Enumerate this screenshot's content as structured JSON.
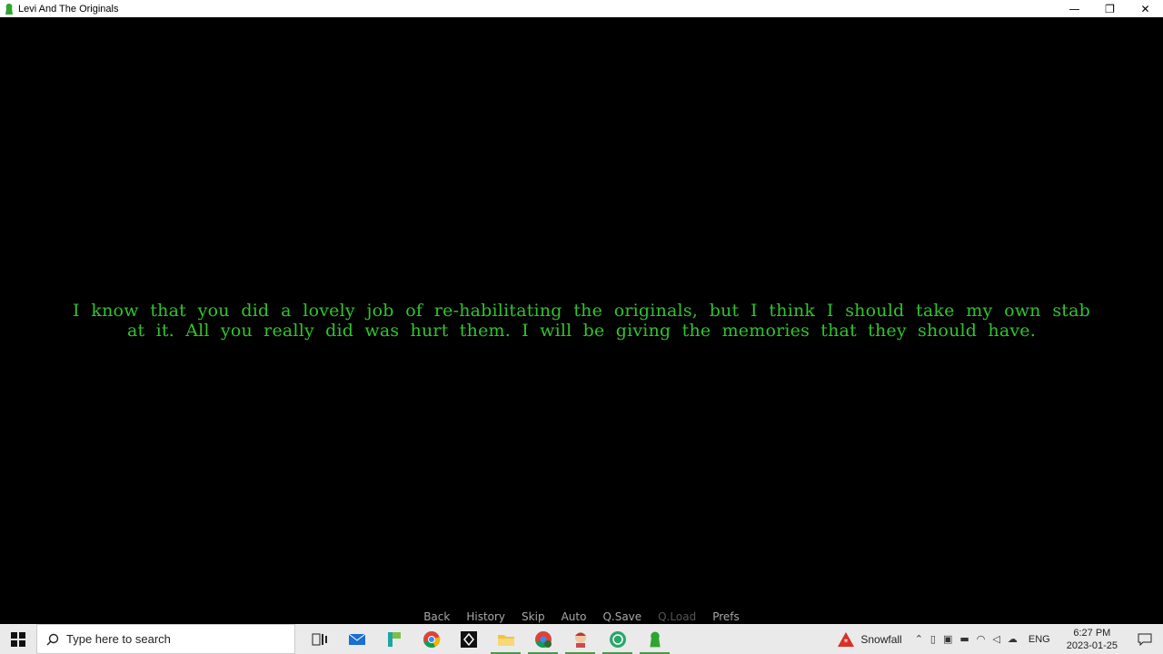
{
  "window": {
    "title": "Levi And The Originals",
    "minimize_glyph": "—",
    "restore_glyph": "❐",
    "close_glyph": "✕"
  },
  "game": {
    "dialogue": "I know that you did a lovely job of re-habilitating the originals, but I think I should take my own stab at it. All you really did was hurt them. I will be giving the memories that they should have.",
    "quick_menu": [
      "Back",
      "History",
      "Skip",
      "Auto",
      "Q.Save",
      "Q.Load",
      "Prefs"
    ],
    "text_color": "#2fc42f"
  },
  "taskbar": {
    "search_placeholder": "Type here to search",
    "pinned": [
      "task-view-icon",
      "mail-icon",
      "file-app-icon",
      "chrome-icon",
      "unity-icon",
      "file-explorer-icon",
      "chrome-profile-icon",
      "game-app-icon",
      "green-circle-app-icon",
      "levi-game-icon"
    ],
    "weather": "Snowfall",
    "language": "ENG",
    "time": "6:27 PM",
    "date": "2023-01-25"
  }
}
